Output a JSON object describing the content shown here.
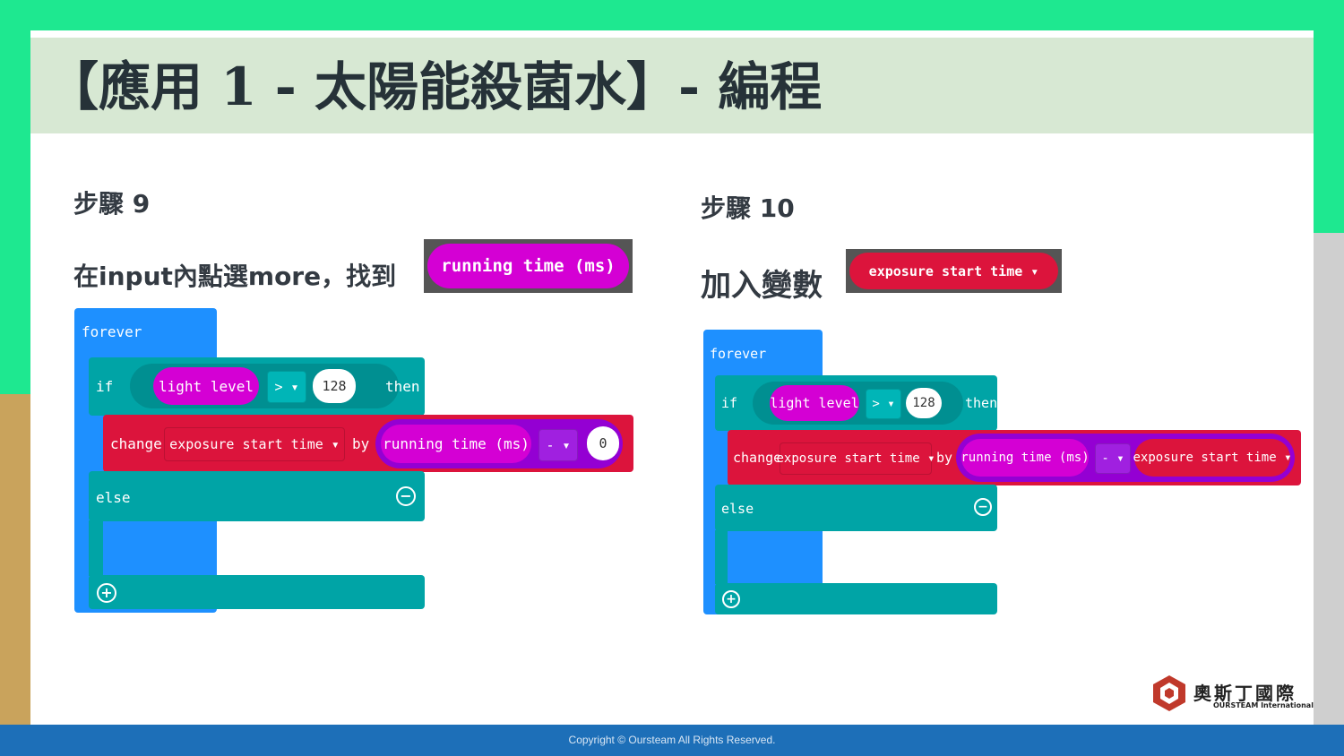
{
  "slide": {
    "title": "【應用 1 - 太陽能殺菌水】- 編程",
    "footer": "Copyright © Oursteam All Rights Reserved."
  },
  "left": {
    "step_label": "步驟 9",
    "instruction": "在input內點選more，找到",
    "reporter": "running time (ms)",
    "blocks": {
      "forever": "forever",
      "if": "if",
      "condition_var": "light level",
      "operator": ">",
      "threshold": "128",
      "then": "then",
      "change": "change",
      "change_var": "exposure start time",
      "by": "by",
      "operand_left": "running time (ms)",
      "minus": "-",
      "operand_right": "0",
      "else": "else"
    }
  },
  "right": {
    "step_label": "步驟 10",
    "instruction": "加入變數",
    "variable": "exposure start time",
    "blocks": {
      "forever": "forever",
      "if": "if",
      "condition_var": "light level",
      "operator": ">",
      "threshold": "128",
      "then": "then",
      "change": "change",
      "change_var": "exposure start time",
      "by": "by",
      "operand_left": "running time (ms)",
      "minus": "-",
      "operand_right": "exposure start time",
      "else": "else"
    }
  },
  "logo": {
    "name_zh": "奧斯丁國際",
    "name_en": "OURSTEAM International"
  },
  "colors": {
    "loops": "#1e90ff",
    "logic": "#00a4a6",
    "variables": "#dc143c",
    "input": "#d400d4",
    "math": "#9400d3",
    "header_bg": "#d7e8d3",
    "footer_bg": "#1d6fb8"
  }
}
